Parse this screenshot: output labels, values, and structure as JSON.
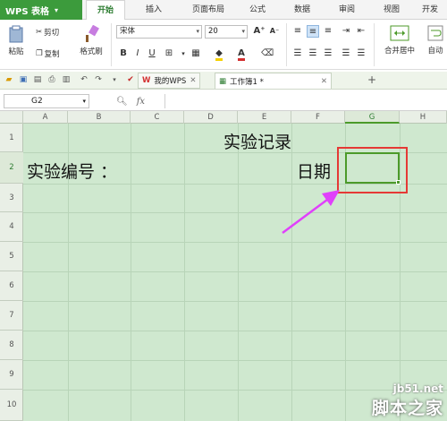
{
  "app": {
    "name": "WPS 表格"
  },
  "menu_tabs": [
    "开始",
    "插入",
    "页面布局",
    "公式",
    "数据",
    "审阅",
    "视图",
    "开发"
  ],
  "ribbon": {
    "paste": "粘贴",
    "cut": "剪切",
    "copy": "复制",
    "format_painter": "格式刷",
    "font_name": "宋体",
    "font_size": "20",
    "bold": "B",
    "italic": "I",
    "underline": "U",
    "font_grow": "A⁺",
    "font_shrink": "A⁻",
    "merge_center": "合并居中",
    "auto_wrap": "自动"
  },
  "doc_tabs": [
    {
      "label": "我的WPS",
      "active": false
    },
    {
      "label": "工作簿1 *",
      "active": true
    }
  ],
  "formula_bar": {
    "cell_ref": "G2",
    "fx": "fx",
    "value": ""
  },
  "columns": [
    "A",
    "B",
    "C",
    "D",
    "E",
    "F",
    "G",
    "H"
  ],
  "selected_column": "G",
  "rows": [
    "1",
    "2",
    "3",
    "4",
    "5",
    "6",
    "7",
    "8",
    "9",
    "10"
  ],
  "selected_row": "2",
  "cells": {
    "title": "实验记录",
    "exp_number": "实验编号 ：",
    "date": "日期"
  },
  "watermark": {
    "site": "jb51.net",
    "name": "脚本之家"
  },
  "colors": {
    "brand": "#3c9b3c",
    "sheet_bg": "#cfe8cf",
    "highlight": "#e53935",
    "arrow": "#e040fb",
    "selection": "#4c9a2a"
  }
}
